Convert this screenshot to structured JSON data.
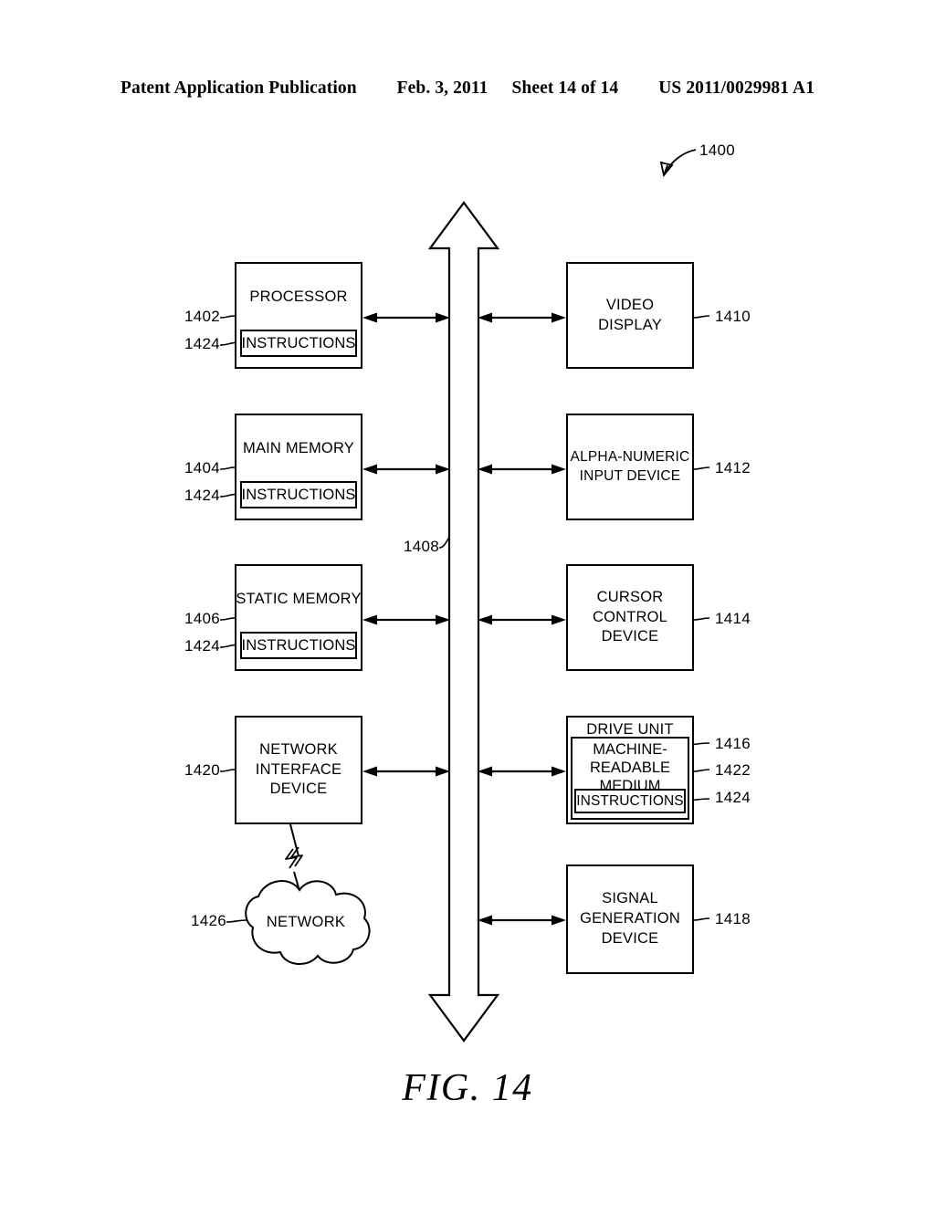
{
  "header": {
    "publication": "Patent Application Publication",
    "date": "Feb. 3, 2011",
    "sheet": "Sheet 14 of 14",
    "docnum": "US 2011/0029981 A1"
  },
  "figure": {
    "caption": "FIG. 14",
    "system_ref": "1400",
    "bus_ref": "1408"
  },
  "blocks": {
    "processor": {
      "title": "PROCESSOR",
      "ref": "1402",
      "instructions": "INSTRUCTIONS",
      "instructions_ref": "1424"
    },
    "main_memory": {
      "title": "MAIN MEMORY",
      "ref": "1404",
      "instructions": "INSTRUCTIONS",
      "instructions_ref": "1424"
    },
    "static_memory": {
      "title": "STATIC MEMORY",
      "ref": "1406",
      "instructions": "INSTRUCTIONS",
      "instructions_ref": "1424"
    },
    "network_interface": {
      "line1": "NETWORK",
      "line2": "INTERFACE",
      "line3": "DEVICE",
      "ref": "1420"
    },
    "network_cloud": {
      "label": "NETWORK",
      "ref": "1426"
    },
    "video_display": {
      "line1": "VIDEO",
      "line2": "DISPLAY",
      "ref": "1410"
    },
    "alpha_numeric_input": {
      "line1": "ALPHA-NUMERIC",
      "line2": "INPUT DEVICE",
      "ref": "1412"
    },
    "cursor_control": {
      "line1": "CURSOR",
      "line2": "CONTROL",
      "line3": "DEVICE",
      "ref": "1414"
    },
    "drive_unit": {
      "title": "DRIVE UNIT",
      "ref": "1416",
      "medium_line1": "MACHINE-",
      "medium_line2": "READABLE",
      "medium_line3": "MEDIUM",
      "medium_ref": "1422",
      "instructions": "INSTRUCTIONS",
      "instructions_ref": "1424"
    },
    "signal_generation": {
      "line1": "SIGNAL",
      "line2": "GENERATION",
      "line3": "DEVICE",
      "ref": "1418"
    }
  },
  "colors": {
    "ink": "#000000",
    "paper": "#ffffff"
  }
}
